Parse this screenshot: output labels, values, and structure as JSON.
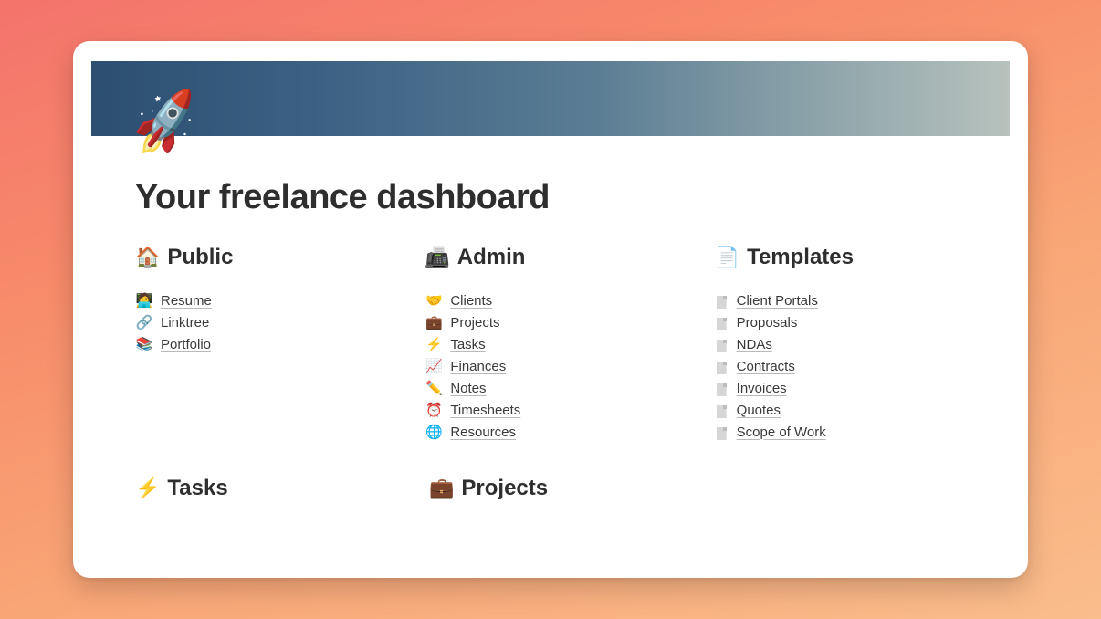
{
  "page": {
    "icon_emoji": "🚀",
    "title": "Your freelance dashboard"
  },
  "sections": {
    "public": {
      "emoji": "🏠",
      "title": "Public",
      "items": [
        {
          "emoji": "🧑‍💻",
          "label": "Resume"
        },
        {
          "emoji": "🔗",
          "label": "Linktree"
        },
        {
          "emoji": "📚",
          "label": "Portfolio"
        }
      ]
    },
    "admin": {
      "emoji": "📠",
      "title": "Admin",
      "items": [
        {
          "emoji": "🤝",
          "label": "Clients"
        },
        {
          "emoji": "💼",
          "label": "Projects"
        },
        {
          "emoji": "⚡",
          "label": "Tasks"
        },
        {
          "emoji": "📈",
          "label": "Finances"
        },
        {
          "emoji": "✏️",
          "label": "Notes"
        },
        {
          "emoji": "⏰",
          "label": "Timesheets"
        },
        {
          "emoji": "🌐",
          "label": "Resources"
        }
      ]
    },
    "templates": {
      "emoji": "📄",
      "title": "Templates",
      "items": [
        {
          "emoji": "__page__",
          "label": "Client Portals"
        },
        {
          "emoji": "__page__",
          "label": "Proposals"
        },
        {
          "emoji": "__page__",
          "label": "NDAs"
        },
        {
          "emoji": "__page__",
          "label": "Contracts"
        },
        {
          "emoji": "__page__",
          "label": "Invoices"
        },
        {
          "emoji": "__page__",
          "label": "Quotes"
        },
        {
          "emoji": "__page__",
          "label": "Scope of Work"
        }
      ]
    },
    "tasks": {
      "emoji": "⚡",
      "title": "Tasks"
    },
    "projects": {
      "emoji": "💼",
      "title": "Projects"
    }
  }
}
